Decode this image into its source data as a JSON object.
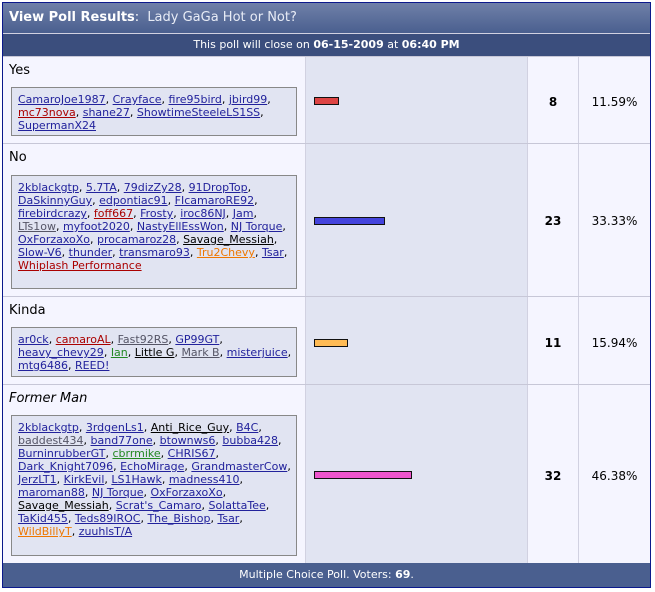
{
  "header": {
    "title": "View Poll Results",
    "question": "Lady GaGa Hot or Not?"
  },
  "close_bar": {
    "prefix": "This poll will close on ",
    "date": "06-15-2009",
    "at": " at ",
    "time": "06:40 PM"
  },
  "options": [
    {
      "label": "Yes",
      "italic": false,
      "count": "8",
      "percent": "11.59%",
      "fraction": 0.1159,
      "bar_color": "#dd4444",
      "voters": [
        {
          "name": "CamaroJoe1987",
          "c": ""
        },
        {
          "name": "Crayface",
          "c": ""
        },
        {
          "name": "fire95bird",
          "c": ""
        },
        {
          "name": "jbird99",
          "c": ""
        },
        {
          "name": "mc73nova",
          "c": "red"
        },
        {
          "name": "shane27",
          "c": ""
        },
        {
          "name": "ShowtimeSteeleLS1SS",
          "c": ""
        },
        {
          "name": "SupermanX24",
          "c": ""
        }
      ]
    },
    {
      "label": "No",
      "italic": false,
      "count": "23",
      "percent": "33.33%",
      "fraction": 0.3333,
      "bar_color": "#4444dd",
      "voters": [
        {
          "name": "2kblackgtp",
          "c": ""
        },
        {
          "name": "5.7TA",
          "c": ""
        },
        {
          "name": "79dizZy28",
          "c": ""
        },
        {
          "name": "91DropTop",
          "c": ""
        },
        {
          "name": "DaSkinnyGuy",
          "c": ""
        },
        {
          "name": "edpontiac91",
          "c": ""
        },
        {
          "name": "FIcamaroRE92",
          "c": ""
        },
        {
          "name": "firebirdcrazy",
          "c": ""
        },
        {
          "name": "foff667",
          "c": "red"
        },
        {
          "name": "Frosty",
          "c": ""
        },
        {
          "name": "iroc86NJ",
          "c": ""
        },
        {
          "name": "Jam",
          "c": ""
        },
        {
          "name": "LTs1ow",
          "c": "gray"
        },
        {
          "name": "myfoot2020",
          "c": ""
        },
        {
          "name": "NastyEllEssWon",
          "c": ""
        },
        {
          "name": "NJ Torque",
          "c": ""
        },
        {
          "name": "OxForzaxoXo",
          "c": ""
        },
        {
          "name": "procamaroz28",
          "c": ""
        },
        {
          "name": "Savage_Messiah",
          "c": "black"
        },
        {
          "name": "Slow-V6",
          "c": ""
        },
        {
          "name": "thunder",
          "c": ""
        },
        {
          "name": "transmaro93",
          "c": ""
        },
        {
          "name": "Tru2Chevy",
          "c": "orange"
        },
        {
          "name": "Tsar",
          "c": ""
        },
        {
          "name": "Whiplash Performance",
          "c": "red"
        }
      ]
    },
    {
      "label": "Kinda",
      "italic": false,
      "count": "11",
      "percent": "15.94%",
      "fraction": 0.1594,
      "bar_color": "#ffbb55",
      "voters": [
        {
          "name": "ar0ck",
          "c": ""
        },
        {
          "name": "camaroAL",
          "c": "red"
        },
        {
          "name": "Fast92RS",
          "c": "gray"
        },
        {
          "name": "GP99GT",
          "c": ""
        },
        {
          "name": "heavy_chevy29",
          "c": ""
        },
        {
          "name": "Ian",
          "c": "green"
        },
        {
          "name": "Little G",
          "c": "black"
        },
        {
          "name": "Mark B",
          "c": "gray"
        },
        {
          "name": "misterjuice",
          "c": ""
        },
        {
          "name": "mtg6486",
          "c": ""
        },
        {
          "name": "REED!",
          "c": ""
        }
      ]
    },
    {
      "label": "Former Man",
      "italic": true,
      "count": "32",
      "percent": "46.38%",
      "fraction": 0.4638,
      "bar_color": "#ee55cc",
      "voters": [
        {
          "name": "2kblackgtp",
          "c": ""
        },
        {
          "name": "3rdgenLs1",
          "c": ""
        },
        {
          "name": "Anti_Rice_Guy",
          "c": "black"
        },
        {
          "name": "B4C",
          "c": ""
        },
        {
          "name": "baddest434",
          "c": "gray"
        },
        {
          "name": "band77one",
          "c": ""
        },
        {
          "name": "btownws6",
          "c": ""
        },
        {
          "name": "bubba428",
          "c": ""
        },
        {
          "name": "BurninrubberGT",
          "c": ""
        },
        {
          "name": "cbrrmike",
          "c": "green"
        },
        {
          "name": "CHRIS67",
          "c": ""
        },
        {
          "name": "Dark_Knight7096",
          "c": ""
        },
        {
          "name": "EchoMirage",
          "c": ""
        },
        {
          "name": "GrandmasterCow",
          "c": ""
        },
        {
          "name": "JerzLT1",
          "c": ""
        },
        {
          "name": "KirkEvil",
          "c": ""
        },
        {
          "name": "LS1Hawk",
          "c": ""
        },
        {
          "name": "madness410",
          "c": ""
        },
        {
          "name": "maroman88",
          "c": ""
        },
        {
          "name": "NJ Torque",
          "c": ""
        },
        {
          "name": "OxForzaxoXo",
          "c": ""
        },
        {
          "name": "Savage_Messiah",
          "c": "black"
        },
        {
          "name": "Scrat's_Camaro",
          "c": ""
        },
        {
          "name": "SolattaTee",
          "c": ""
        },
        {
          "name": "TaKid455",
          "c": ""
        },
        {
          "name": "Teds89IROC",
          "c": ""
        },
        {
          "name": "The_Bishop",
          "c": ""
        },
        {
          "name": "Tsar",
          "c": ""
        },
        {
          "name": "WildBillyT",
          "c": "orange"
        },
        {
          "name": "zuuhlsT/A",
          "c": ""
        }
      ]
    }
  ],
  "footer": {
    "prefix": "Multiple Choice Poll. Voters: ",
    "voters": "69",
    "suffix": "."
  }
}
